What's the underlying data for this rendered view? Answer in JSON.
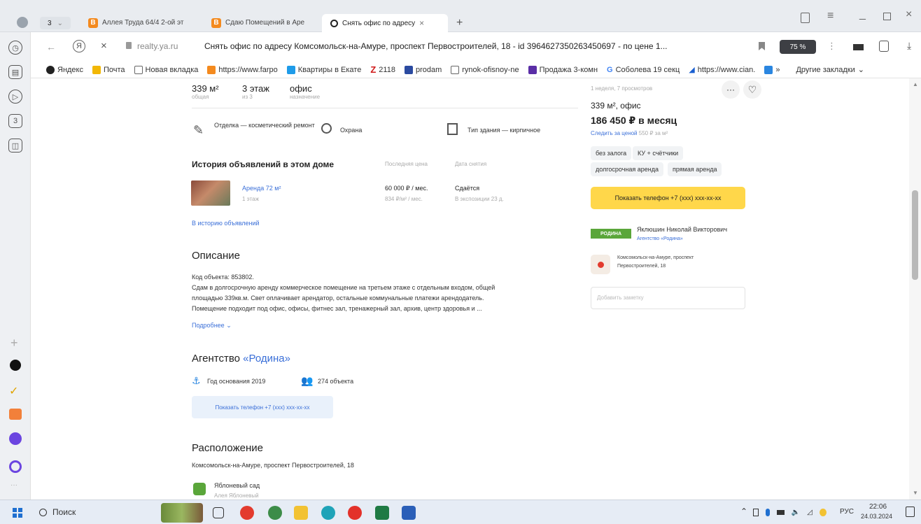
{
  "browser": {
    "tab_count": "3",
    "tabs": [
      {
        "label": "Аллея Труда 64/4 2-ой эт"
      },
      {
        "label": "Сдаю Помещений в Аре"
      },
      {
        "label": "Снять офис по адресу"
      }
    ],
    "domain": "realty.ya.ru",
    "page_title": "Снять офис по адресу Комсомольск-на-Амуре, проспект Первостроителей, 18 - id 3964627350263450697 - по цене 1...",
    "zoom": "75 %",
    "bookmarks": [
      "Яндекс",
      "Почта",
      "Новая вкладка",
      "https://www.farpo",
      "Квартиры в Екате",
      "2118",
      "prodam",
      "rynok-ofisnoy-ne",
      "Продажа 3-комн",
      "Соболева 19 секц",
      "https://www.cian."
    ],
    "other_bookmarks": "Другие закладки"
  },
  "listing": {
    "area_value": "339 м²",
    "area_label": "общая",
    "floor_value": "3 этаж",
    "floor_label": "из 3",
    "purpose_value": "офис",
    "purpose_label": "назначение",
    "feature_finish": "Отделка — косметический ремонт",
    "feature_security": "Охрана",
    "feature_building": "Тип здания — кирпичное",
    "history_title": "История объявлений в этом доме",
    "history_col_price": "Последняя цена",
    "history_col_date": "Дата снятия",
    "history_item": {
      "title": "Аренда 72 м²",
      "floor": "1 этаж",
      "price": "60 000 ₽ / мес.",
      "price_sub": "834 ₽/м² / мес.",
      "status": "Сдаётся",
      "status_sub": "В экспозиции 23 д."
    },
    "history_link": "В историю объявлений",
    "desc_title": "Описание",
    "desc_code": "Код объекта: 853802.",
    "desc_line1": "Сдам в долгосрочную аренду коммерческое помещение на третьем этаже с отдельным входом, общей",
    "desc_line2": "площадью 339кв.м. Свет оплачивает арендатор, остальные коммунальные платежи арендодатель.",
    "desc_line3": "Помещение подходит под офис, офисы, фитнес зал, тренажерный зал, архив, центр здоровья и ...",
    "desc_more": "Подробнее",
    "agency_prefix": "Агентство ",
    "agency_name": "«Родина»",
    "agency_founded": "Год основания 2019",
    "agency_objects": "274 объекта",
    "agency_phone_btn": "Показать телефон +7 (xxx) xxx-xx-xx",
    "location_title": "Расположение",
    "location_address": "Комсомольск-на-Амуре, проспект Первостроителей, 18",
    "nearby_name": "Яблоневый сад",
    "nearby_sub": "Алея Яблоневый"
  },
  "card": {
    "meta": "1 неделя, 7 просмотров",
    "title": "339 м², офис",
    "price": "186 450 ₽ в месяц",
    "track": "Следить за ценой",
    "price_per": "550 ₽ за м²",
    "tags": [
      "без залога",
      "КУ + счётчики",
      "долгосрочная аренда",
      "прямая аренда"
    ],
    "phone_btn": "Показать телефон +7 (xxx) xxx-xx-xx",
    "agent_logo": "РОДИНА",
    "agent_name": "Яклюшин Николай Викторович",
    "agent_agency": "Агентство «Родина»",
    "address_line1": "Комсомольск-на-Амуре, проспект",
    "address_line2": "Первостроителей, 18",
    "note_placeholder": "Добавить заметку"
  },
  "taskbar": {
    "search": "Поиск",
    "lang": "РУС",
    "time": "22:06",
    "date": "24.03.2024"
  },
  "colors": {
    "accent_yellow": "#ffd74a",
    "link_blue": "#3a6fd8",
    "agency_green": "#5aa63a"
  }
}
